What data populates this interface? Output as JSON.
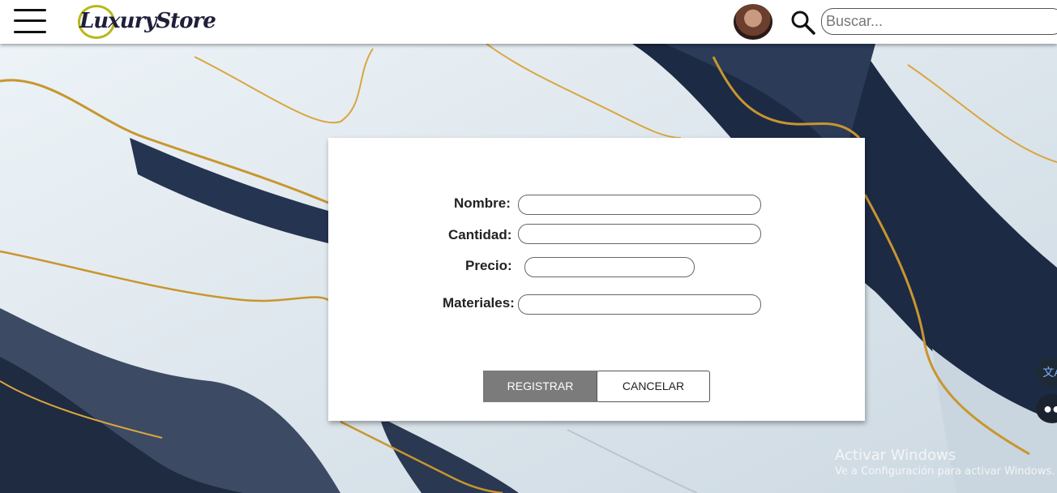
{
  "header": {
    "logo_text": "LuxuryStore",
    "search_placeholder": "Buscar..."
  },
  "form": {
    "fields": [
      {
        "label": "Nombre:",
        "value": ""
      },
      {
        "label": "Cantidad:",
        "value": ""
      },
      {
        "label": "Precio:",
        "value": ""
      },
      {
        "label": "Materiales:",
        "value": ""
      }
    ],
    "register_label": "REGISTRAR",
    "cancel_label": "CANCELAR"
  },
  "watermark": {
    "line1": "Activar Windows",
    "line2": "Ve a Configuración para activar Windows."
  },
  "colors": {
    "register_bg": "#7b7b7b",
    "topbar_bg": "#ffffff",
    "logo_ring": "#b9b71a"
  },
  "icons": {
    "menu": "hamburger-icon",
    "search": "search-icon",
    "translate": "translate-icon",
    "assistant": "assistant-icon"
  }
}
